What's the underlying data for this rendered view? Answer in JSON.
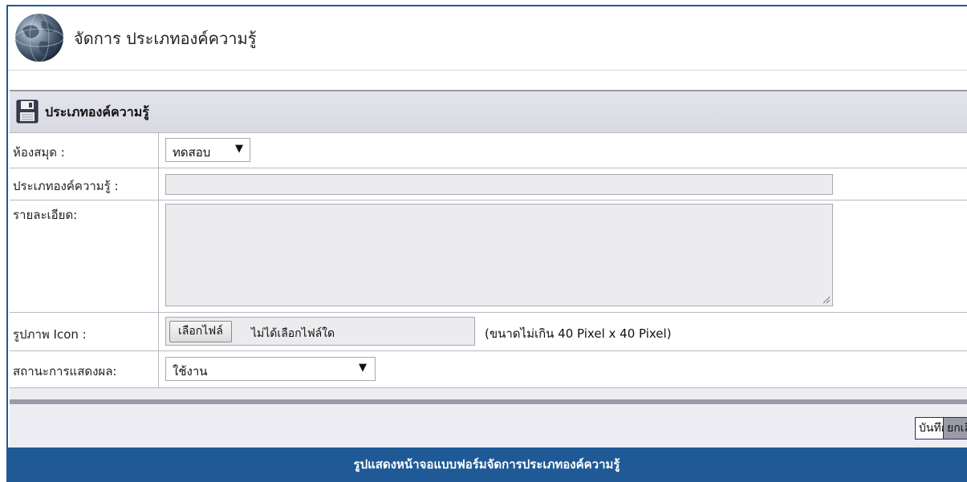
{
  "header": {
    "title": "จัดการ ประเภทองค์ความรู้",
    "logo_icon": "globe-icon"
  },
  "form": {
    "panel_title": "ประเภทองค์ความรู้",
    "panel_icon": "floppy-disk-icon",
    "fields": {
      "library": {
        "label": "ห้องสมุด :",
        "selected": "ทดสอบ"
      },
      "category": {
        "label": "ประเภทองค์ความรู้ :",
        "value": ""
      },
      "description": {
        "label": "รายละเอียด:",
        "value": ""
      },
      "icon_image": {
        "label": "รูปภาพ Icon :",
        "button_label": "เลือกไฟล์",
        "status": "ไม่ได้เลือกไฟล์ใด",
        "hint": "(ขนาดไม่เกิน 40 Pixel x 40 Pixel)"
      },
      "display_status": {
        "label": "สถานะการแสดงผล:",
        "selected": "ใช้งาน"
      }
    },
    "buttons": {
      "save_label": "บันทึก",
      "cancel_label": "ยกเลิก"
    }
  },
  "caption": "รูปแสดงหน้าจอแบบฟอร์มจัดการประเภทองค์ความรู้",
  "colors": {
    "frame_blue": "#1f5a96",
    "panel_gray": "#ececf2",
    "divider_gray": "#9a9aa8"
  }
}
